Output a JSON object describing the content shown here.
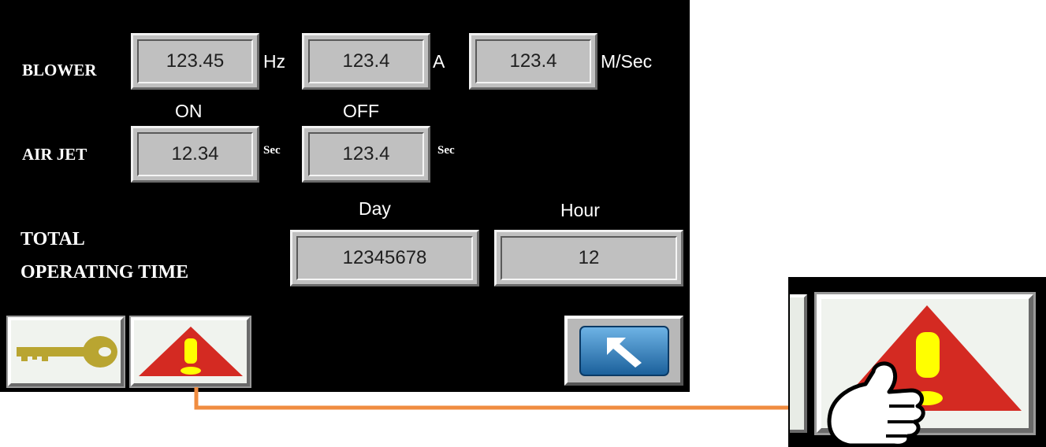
{
  "blower": {
    "label": "BLOWER",
    "frequency": "123.45",
    "frequency_unit": "Hz",
    "current": "123.4",
    "current_unit": "A",
    "speed": "123.4",
    "speed_unit": "M/Sec"
  },
  "air_jet": {
    "label": "AIR JET",
    "on_header": "ON",
    "off_header": "OFF",
    "on_value": "12.34",
    "on_unit": "Sec",
    "off_value": "123.4",
    "off_unit": "Sec"
  },
  "operating_time": {
    "label_line1": "TOTAL",
    "label_line2": "OPERATING TIME",
    "day_header": "Day",
    "hour_header": "Hour",
    "day_value": "12345678",
    "hour_value": "12"
  },
  "buttons": {
    "key": {
      "icon": "key-icon"
    },
    "alarm": {
      "icon": "warning-icon"
    },
    "return": {
      "icon": "return-arrow-icon"
    }
  },
  "colors": {
    "panel": "#000000",
    "field": "#c0c0c0",
    "key": "#b9a531",
    "warning_triangle": "#d42a22",
    "warning_mark": "#ffff00",
    "return_button": "#1f78b4",
    "connector": "#f08c40"
  }
}
